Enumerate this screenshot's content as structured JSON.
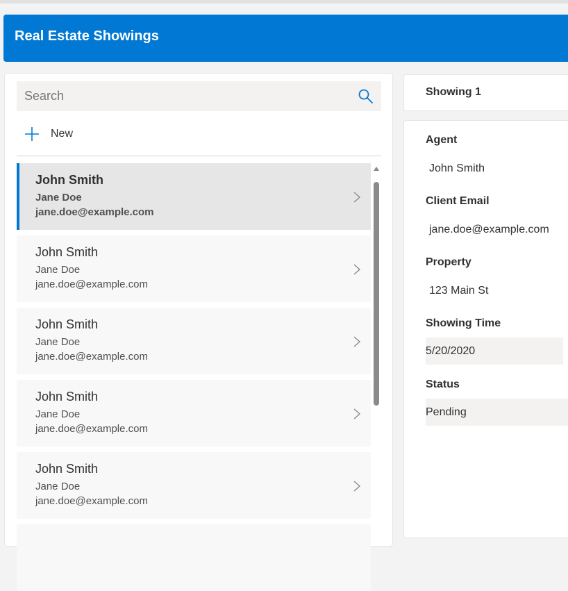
{
  "app": {
    "title": "Real Estate Showings"
  },
  "search": {
    "placeholder": "Search"
  },
  "toolbar": {
    "new_label": "New"
  },
  "list": {
    "items": [
      {
        "agent": "John Smith",
        "client": "Jane Doe",
        "email": "jane.doe@example.com",
        "selected": true
      },
      {
        "agent": "John Smith",
        "client": "Jane Doe",
        "email": "jane.doe@example.com",
        "selected": false
      },
      {
        "agent": "John Smith",
        "client": "Jane Doe",
        "email": "jane.doe@example.com",
        "selected": false
      },
      {
        "agent": "John Smith",
        "client": "Jane Doe",
        "email": "jane.doe@example.com",
        "selected": false
      },
      {
        "agent": "John Smith",
        "client": "Jane Doe",
        "email": "jane.doe@example.com",
        "selected": false
      }
    ]
  },
  "detail": {
    "title": "Showing 1",
    "fields": {
      "agent": {
        "label": "Agent",
        "value": "John Smith"
      },
      "client_email": {
        "label": "Client Email",
        "value": "jane.doe@example.com"
      },
      "property": {
        "label": "Property",
        "value": "123 Main St"
      },
      "showing_time": {
        "label": "Showing Time",
        "value": "5/20/2020"
      },
      "status": {
        "label": "Status",
        "value": "Pending"
      }
    }
  },
  "colors": {
    "accent": "#0078d4",
    "selected_row": "#e6e6e6",
    "row": "#f8f8f8"
  },
  "icons": {
    "search": "search-icon",
    "new": "plus-icon",
    "row": "chevron-right-icon"
  }
}
